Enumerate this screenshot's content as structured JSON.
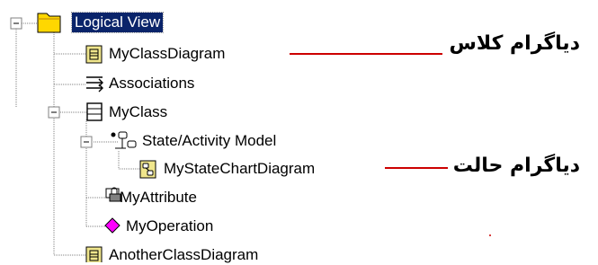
{
  "tree": {
    "root_label": "Logical View",
    "items": [
      {
        "label": "MyClassDiagram",
        "icon": "class-diagram-icon"
      },
      {
        "label": "Associations",
        "icon": "associations-icon"
      },
      {
        "label": "MyClass",
        "icon": "class-icon"
      },
      {
        "label": "State/Activity Model",
        "icon": "state-activity-model-icon"
      },
      {
        "label": "MyStateChartDiagram",
        "icon": "statechart-diagram-icon"
      },
      {
        "label": "MyAttribute",
        "icon": "attribute-icon"
      },
      {
        "label": "MyOperation",
        "icon": "operation-icon"
      },
      {
        "label": "AnotherClassDiagram",
        "icon": "class-diagram-icon"
      }
    ]
  },
  "annotations": [
    {
      "text": "دیاگرام کلاس",
      "arrow_color": "#cc0000"
    },
    {
      "text": "دیاگرام حالت",
      "arrow_color": "#cc0000"
    }
  ],
  "colors": {
    "selection": "#0a246a",
    "annotation_arrow": "#cc0000",
    "folder": "#ffd700",
    "class_diagram": "#f0e68c",
    "operation": "#ff00ff"
  }
}
